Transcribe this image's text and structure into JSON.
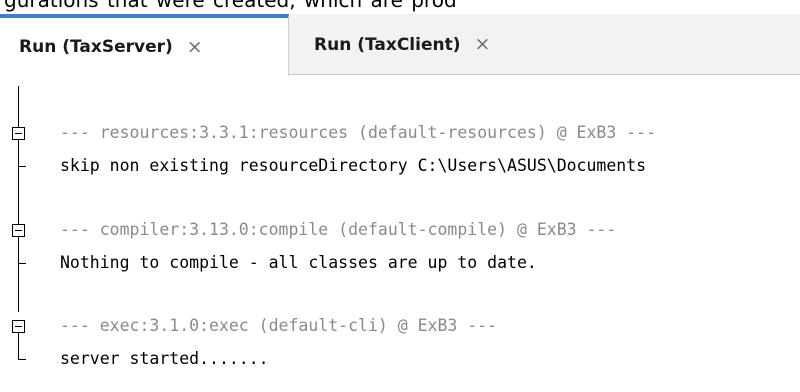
{
  "window": {
    "above_text": "gurations that were created, which are prod"
  },
  "tabs": [
    {
      "label": "Run (TaxServer)",
      "close": "×",
      "active": true
    },
    {
      "label": "Run (TaxClient)",
      "close": "×",
      "active": false
    }
  ],
  "console": {
    "groups": [
      {
        "header": "--- resources:3.3.1:resources (default-resources) @ ExB3 ---",
        "output": "skip non existing resourceDirectory C:\\Users\\ASUS\\Documents"
      },
      {
        "header": "--- compiler:3.13.0:compile (default-compile) @ ExB3 ---",
        "output": "Nothing to compile - all classes are up to date."
      },
      {
        "header": "--- exec:3.1.0:exec (default-cli) @ ExB3 ---",
        "output": "server started......."
      }
    ]
  },
  "colors": {
    "tab_accent": "#3b7fd0",
    "header_text": "#8a8a8a",
    "output_text": "#000000"
  },
  "icons": [
    "collapse-icon",
    "close-icon"
  ]
}
